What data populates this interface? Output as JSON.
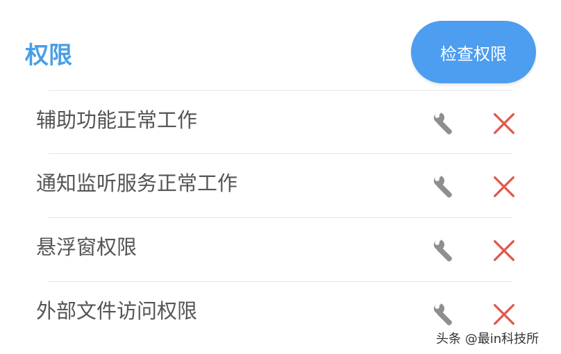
{
  "header": {
    "title": "权限",
    "check_button_label": "检查权限"
  },
  "permissions": [
    {
      "label": "辅助功能正常工作",
      "action_icon": "wrench-icon",
      "status_icon": "cross-icon",
      "status": "not-granted"
    },
    {
      "label": "通知监听服务正常工作",
      "action_icon": "wrench-icon",
      "status_icon": "cross-icon",
      "status": "not-granted"
    },
    {
      "label": "悬浮窗权限",
      "action_icon": "wrench-icon",
      "status_icon": "cross-icon",
      "status": "not-granted"
    },
    {
      "label": "外部文件访问权限",
      "action_icon": "wrench-icon",
      "status_icon": "cross-icon",
      "status": "not-granted"
    }
  ],
  "colors": {
    "accent": "#4a9ee6",
    "button": "#4d9df0",
    "cross": "#e05a4f",
    "wrench": "#8f8f8f",
    "text": "#555555",
    "divider": "#e4e4e4"
  },
  "watermark": "头条 @最in科技所"
}
